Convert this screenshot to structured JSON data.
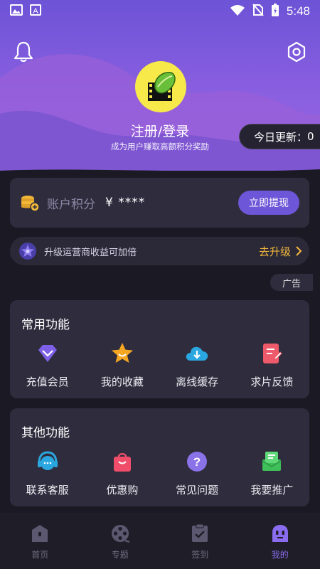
{
  "status_bar": {
    "time": "5:48",
    "icons": [
      "image-icon",
      "text-a-icon",
      "wifi-icon",
      "no-sim-icon",
      "battery-charging-icon"
    ]
  },
  "header": {
    "login_text": "注册/登录",
    "login_subtitle": "成为用户赚取高额积分奖励",
    "today_update_label": "今日更新：",
    "today_update_count": "0",
    "icons": [
      "bell-icon",
      "settings-icon",
      "avatar-logo"
    ]
  },
  "points": {
    "label": "账户积分",
    "amount": "¥ ****",
    "withdraw_label": "立即提现"
  },
  "upgrade": {
    "text": "升级运营商收益可加倍",
    "action_label": "去升级"
  },
  "ad_label": "广告",
  "common_functions": {
    "title": "常用功能",
    "items": [
      {
        "label": "充值会员",
        "icon": "vip-diamond-icon"
      },
      {
        "label": "我的收藏",
        "icon": "star-icon"
      },
      {
        "label": "离线缓存",
        "icon": "cloud-download-icon"
      },
      {
        "label": "求片反馈",
        "icon": "feedback-edit-icon"
      }
    ]
  },
  "other_functions": {
    "title": "其他功能",
    "items": [
      {
        "label": "联系客服",
        "icon": "headset-icon"
      },
      {
        "label": "优惠购",
        "icon": "shopping-bag-icon"
      },
      {
        "label": "常见问题",
        "icon": "question-icon"
      },
      {
        "label": "我要推广",
        "icon": "promote-icon"
      }
    ]
  },
  "tab_bar": {
    "tabs": [
      {
        "label": "首页",
        "icon": "home-icon",
        "active": false
      },
      {
        "label": "专题",
        "icon": "film-reel-icon",
        "active": false
      },
      {
        "label": "签到",
        "icon": "checkin-icon",
        "active": false
      },
      {
        "label": "我的",
        "icon": "profile-icon",
        "active": true
      }
    ]
  },
  "colors": {
    "accent": "#6e56d8",
    "gold": "#f5b83d",
    "card": "#2f2d3d",
    "background": "#1b1a24"
  }
}
